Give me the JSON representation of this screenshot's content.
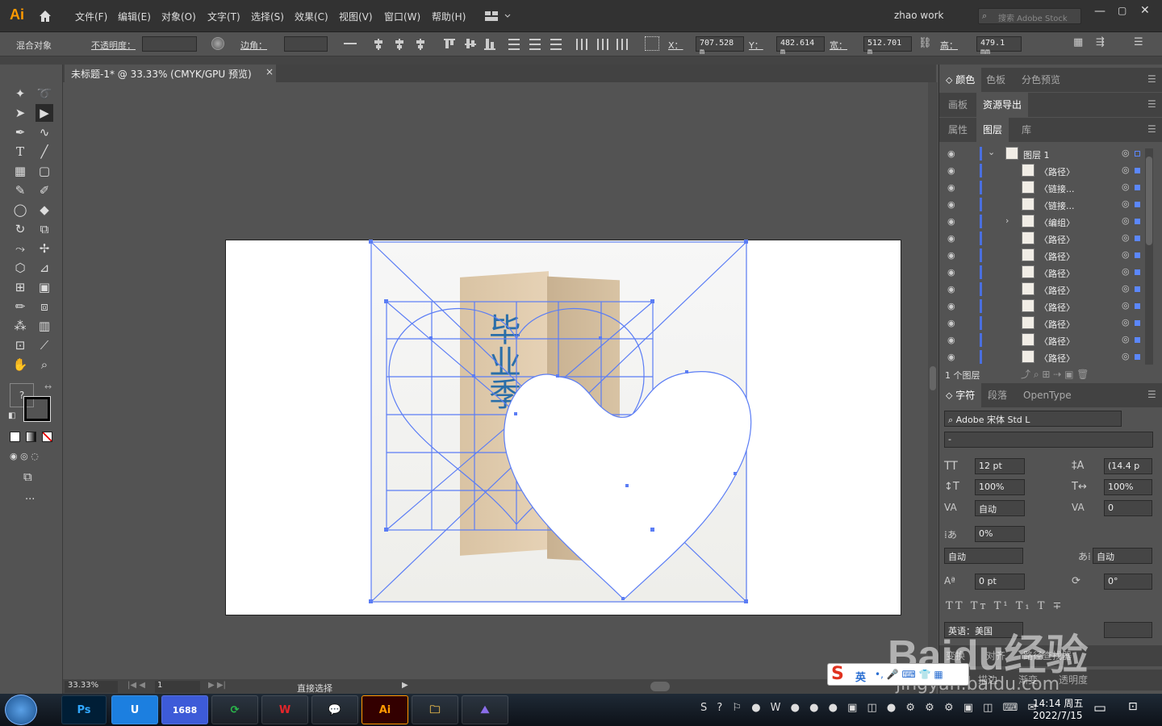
{
  "app": {
    "logo": "Ai",
    "workspace": "zhao work",
    "search_placeholder": "搜索 Adobe Stock"
  },
  "menu": [
    "文件(F)",
    "编辑(E)",
    "对象(O)",
    "文字(T)",
    "选择(S)",
    "效果(C)",
    "视图(V)",
    "窗口(W)",
    "帮助(H)"
  ],
  "control": {
    "object_label": "混合对象",
    "opacity_label": "不透明度：",
    "corner_label": "边角：",
    "x_label": "X：",
    "x_value": "707.528 m",
    "y_label": "Y：",
    "y_value": "482.614 m",
    "w_label": "宽：",
    "w_value": "512.701 m",
    "h_label": "高：",
    "h_value": "479.1 mm"
  },
  "document": {
    "tab_title": "未标题-1* @ 33.33% (CMYK/GPU 预览)",
    "close": "×"
  },
  "status": {
    "zoom": "33.33%",
    "page": "1",
    "tool_name": "直接选择"
  },
  "panels": {
    "group1_tabs": [
      "颜色",
      "色板",
      "分色预览"
    ],
    "group2_tabs": [
      "画板",
      "资源导出"
    ],
    "group3_tabs": [
      "属性",
      "图层",
      "库"
    ],
    "layers": [
      {
        "name": "图层 1"
      },
      {
        "name": "〈路径〉"
      },
      {
        "name": "〈链接..."
      },
      {
        "name": "〈链接..."
      },
      {
        "name": "〈编组〉"
      },
      {
        "name": "〈路径〉"
      },
      {
        "name": "〈路径〉"
      },
      {
        "name": "〈路径〉"
      },
      {
        "name": "〈路径〉"
      },
      {
        "name": "〈路径〉"
      },
      {
        "name": "〈路径〉"
      },
      {
        "name": "〈路径〉"
      },
      {
        "name": "〈路径〉"
      }
    ],
    "layer_count": "1 个图层",
    "char_tabs": [
      "字符",
      "段落",
      "OpenType"
    ],
    "font_family": "Adobe 宋体 Std L",
    "font_style": "-",
    "font_size": "12 pt",
    "leading": "(14.4 p",
    "vscale": "100%",
    "hscale": "100%",
    "kerning": "自动",
    "tracking": "0",
    "tsume": "0%",
    "aki_left": "自动",
    "aki_right": "自动",
    "baseline": "0 pt",
    "rotation": "0°",
    "language": "英语：美国",
    "bottom_tabs": [
      "变换",
      "对齐",
      "路径查找器"
    ],
    "bottom_tabs2": [
      "描边",
      "渐变",
      "透明度"
    ]
  },
  "artwork": {
    "packaging_text": "毕业季"
  },
  "taskbar": {
    "apps": [
      "Ps",
      "1688",
      "Ai"
    ],
    "time": "14:14 周五",
    "date": "2022/7/15",
    "ime_lang": "英"
  },
  "watermark": {
    "brand": "Baidu经验",
    "url": "jingyan.baidu.com"
  }
}
